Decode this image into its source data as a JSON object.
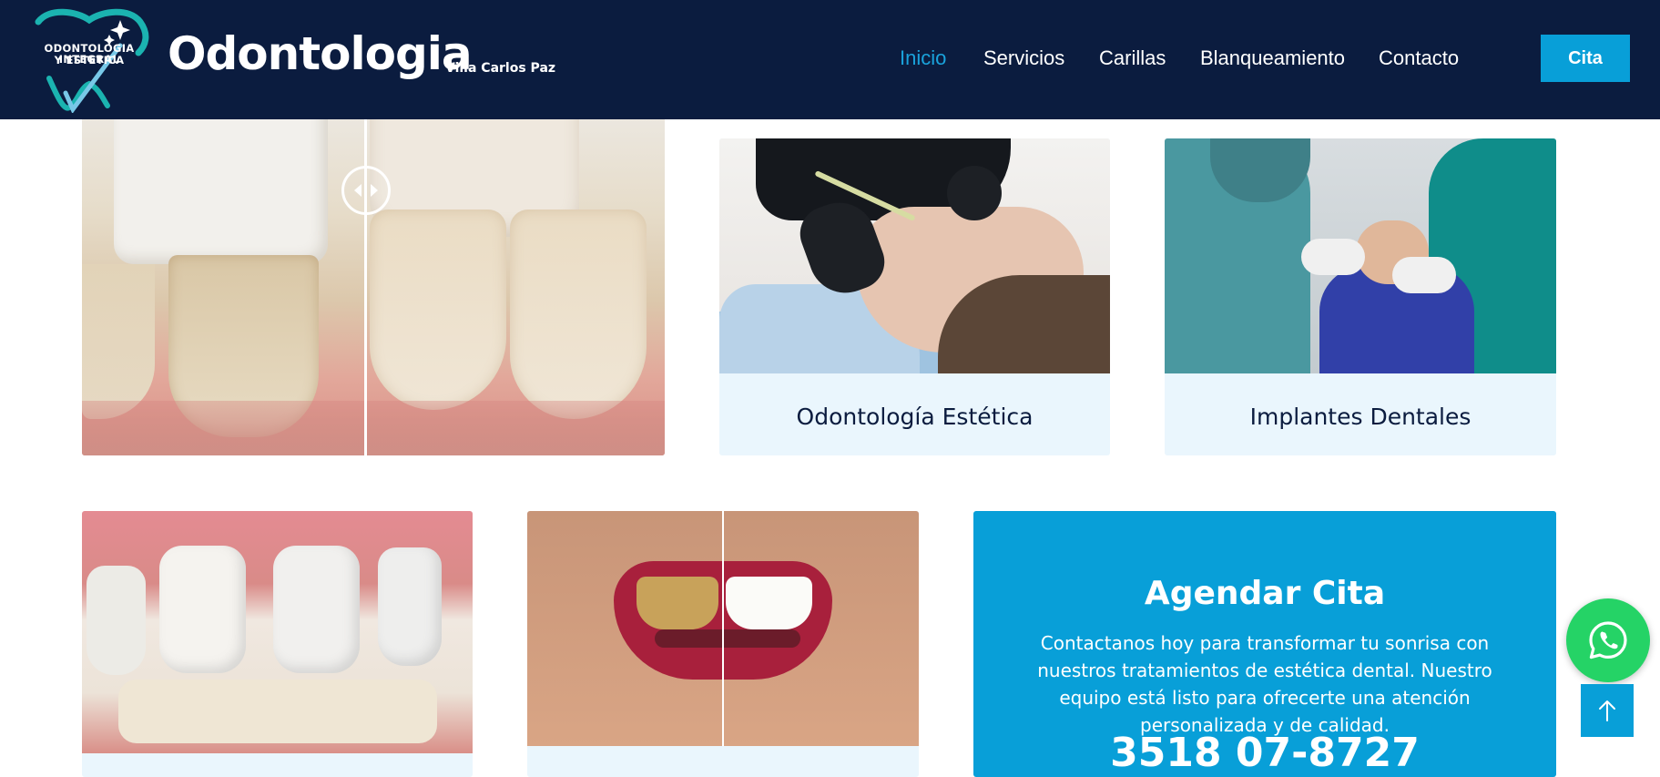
{
  "header": {
    "logo_line1": "ODONTOLOGIA INTEGRAL",
    "logo_line2": "Y ESTETICA",
    "brand_name": "Odontologia",
    "brand_sub": "Villa Carlos Paz",
    "nav": [
      {
        "label": "Inicio",
        "active": true
      },
      {
        "label": "Servicios",
        "active": false
      },
      {
        "label": "Carillas",
        "active": false
      },
      {
        "label": "Blanqueamiento",
        "active": false
      },
      {
        "label": "Contacto",
        "active": false
      }
    ],
    "cta_label": "Cita"
  },
  "cards": [
    {
      "title": "Odontología Estética"
    },
    {
      "title": "Implantes Dentales"
    }
  ],
  "cita": {
    "title": "Agendar Cita",
    "text": "Contactanos hoy para transformar tu sonrisa con nuestros tratamientos de estética dental. Nuestro equipo está listo para ofrecerte una atención personalizada y de calidad.",
    "phone": "3518 07-8727"
  },
  "icons": {
    "whatsapp": "whatsapp-icon",
    "scroll_top": "arrow-up-icon",
    "slider_handle": "left-right-arrows-icon"
  },
  "colors": {
    "header_bg": "#0b1c3f",
    "accent": "#089fd8",
    "nav_active": "#1aa3dc",
    "card_bg": "#eaf6fd",
    "whatsapp": "#25d366"
  }
}
